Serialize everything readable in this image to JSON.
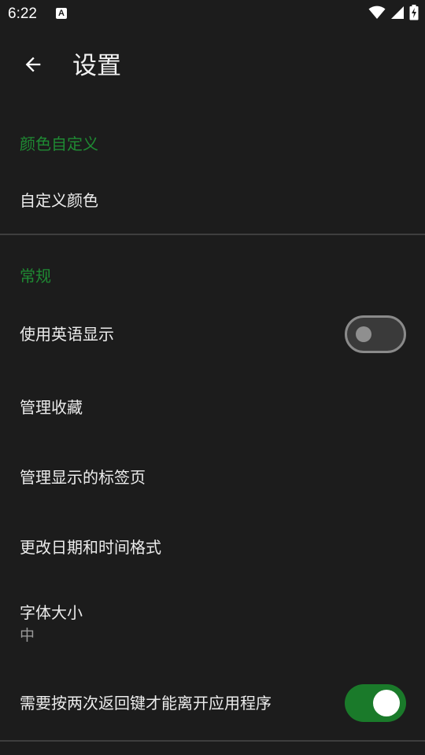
{
  "status_bar": {
    "time": "6:22",
    "notification_icon": "A",
    "icons": [
      "wifi-icon",
      "signal-icon",
      "battery-charging-icon"
    ]
  },
  "app_bar": {
    "title": "设置",
    "back_icon": "arrow-left-icon"
  },
  "sections": {
    "color_custom": {
      "header": "颜色自定义",
      "items": {
        "custom_color": "自定义颜色"
      }
    },
    "general": {
      "header": "常规",
      "items": {
        "english_display": {
          "label": "使用英语显示",
          "enabled": false
        },
        "manage_favorites": "管理收藏",
        "manage_tabs": "管理显示的标签页",
        "date_time_format": "更改日期和时间格式",
        "font_size": {
          "label": "字体大小",
          "value": "中"
        },
        "double_back_exit": {
          "label": "需要按两次返回键才能离开应用程序",
          "enabled": true
        }
      }
    }
  },
  "colors": {
    "background": "#1c1c1c",
    "accent": "#1f8a33",
    "switch_on": "#1a7a2a",
    "divider": "#3e3e3e"
  }
}
